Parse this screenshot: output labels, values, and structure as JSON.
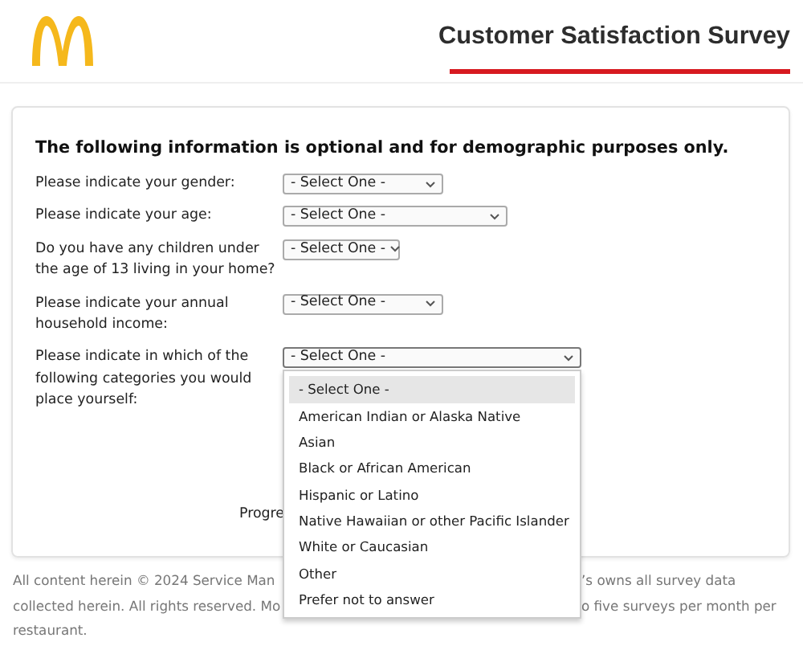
{
  "header": {
    "title": "Customer Satisfaction Survey"
  },
  "card": {
    "heading": "The following information is optional and for demographic purposes only.",
    "questions": [
      {
        "label": "Please indicate your gender:",
        "value": "- Select One -",
        "expanded": false
      },
      {
        "label": "Please indicate your age:",
        "value": "- Select One -",
        "expanded": false
      },
      {
        "label": "Do you have any children under the age of 13 living in your home?",
        "value": "- Select One -",
        "expanded": false
      },
      {
        "label": "Please indicate your annual household income:",
        "value": "- Select One -",
        "expanded": false
      },
      {
        "label": "Please indicate in which of the following categories you would place yourself:",
        "value": "- Select One -",
        "expanded": true,
        "options": [
          {
            "label": "- Select One -",
            "selected": true
          },
          {
            "label": "American Indian or Alaska Native",
            "selected": false
          },
          {
            "label": "Asian",
            "selected": false
          },
          {
            "label": "Black or African American",
            "selected": false
          },
          {
            "label": "Hispanic or Latino",
            "selected": false
          },
          {
            "label": "Native Hawaiian or other Pacific Islander",
            "selected": false
          },
          {
            "label": "White or Caucasian",
            "selected": false
          },
          {
            "label": "Other",
            "selected": false
          },
          {
            "label": "Prefer not to answer",
            "selected": false
          }
        ]
      }
    ],
    "progress_label": "Progre"
  },
  "footer": {
    "lines": [
      {
        "left": "All content herein © 2024 Service Man",
        "right": "’s owns all survey data"
      },
      {
        "left": "collected herein. All rights reserved. Mo",
        "right": "o five surveys per month per"
      },
      {
        "left": "restaurant."
      }
    ]
  }
}
